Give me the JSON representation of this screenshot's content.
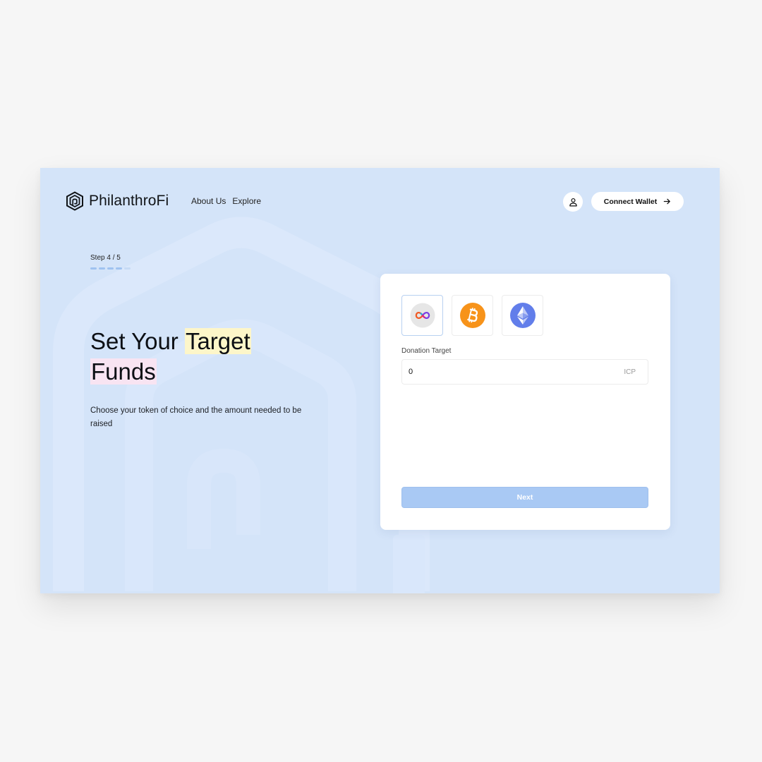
{
  "header": {
    "brand": "PhilanthroFi",
    "nav": [
      {
        "label": "About Us"
      },
      {
        "label": "Explore"
      }
    ],
    "connect_label": "Connect Wallet"
  },
  "step": {
    "label": "Step 4 / 5",
    "current": 4,
    "total": 5
  },
  "hero": {
    "title_part1": "Set Your ",
    "title_highlight1": "Target",
    "title_highlight2": "Funds",
    "description": "Choose your token of choice and the amount needed to be raised"
  },
  "card": {
    "tokens": [
      {
        "icon": "icp-icon",
        "selected": true
      },
      {
        "icon": "bitcoin-icon",
        "selected": false
      },
      {
        "icon": "ethereum-icon",
        "selected": false
      }
    ],
    "field_label": "Donation Target",
    "field_value": "0",
    "field_unit": "ICP",
    "next_label": "Next"
  },
  "colors": {
    "page_background": "#d4e4f9",
    "highlight_yellow": "#fdf6c9",
    "highlight_pink": "#f8e4f2",
    "button_disabled": "#a9c9f4",
    "bitcoin": "#f7931a",
    "ethereum": "#627eea"
  }
}
